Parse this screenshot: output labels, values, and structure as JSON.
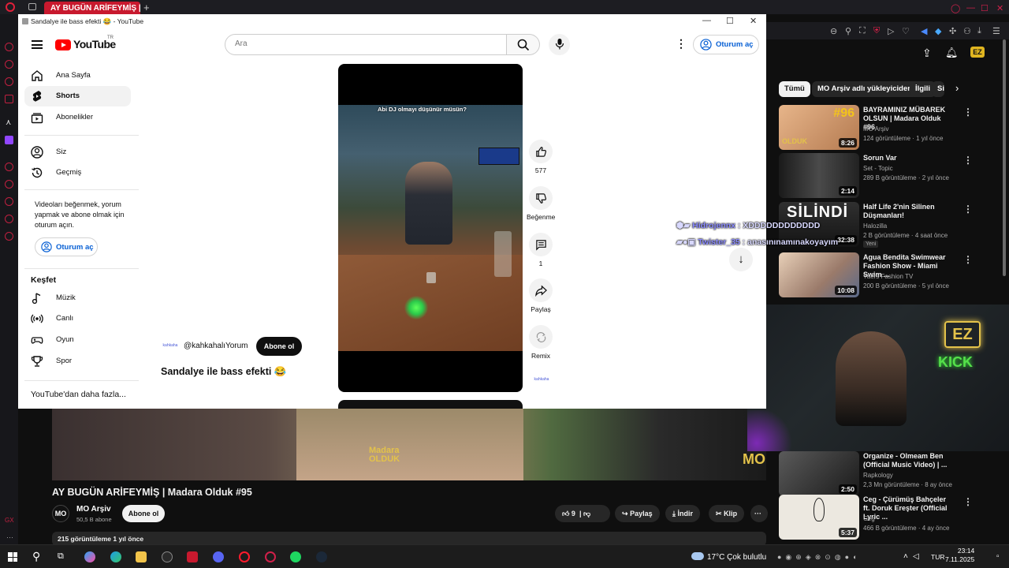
{
  "browser": {
    "tab_title": "AY BUGÜN ARİFEYMİŞ | M",
    "new_tab": "+"
  },
  "pip": {
    "window_title": "Sandalye ile bass efekti 😂 - YouTube",
    "header": {
      "logo_text": "YouTube",
      "logo_region": "TR",
      "search_placeholder": "Ara",
      "sign_in": "Oturum aç"
    },
    "nav": {
      "items": [
        {
          "label": "Ana Sayfa",
          "icon": "home-icon"
        },
        {
          "label": "Shorts",
          "icon": "shorts-icon",
          "active": true
        },
        {
          "label": "Abonelikler",
          "icon": "subscriptions-icon"
        }
      ],
      "you_items": [
        {
          "label": "Siz",
          "icon": "user-icon"
        },
        {
          "label": "Geçmiş",
          "icon": "history-icon"
        }
      ],
      "signin_prompt": "Videoları beğenmek, yorum yapmak ve abone olmak için oturum açın.",
      "signin_button": "Oturum aç",
      "explore_title": "Keşfet",
      "explore_items": [
        {
          "label": "Müzik",
          "icon": "music-icon"
        },
        {
          "label": "Canlı",
          "icon": "live-icon"
        },
        {
          "label": "Oyun",
          "icon": "gaming-icon"
        },
        {
          "label": "Spor",
          "icon": "trophy-icon"
        }
      ],
      "more": "YouTube'dan daha fazla..."
    },
    "short": {
      "caption": "Abi DJ olmayı düşünür müsün?",
      "uploader": "@kahkahalıYorum",
      "subscribe": "Abone ol",
      "title": "Sandalye ile bass efekti 😂",
      "actions": {
        "like_count": "577",
        "dislike_label": "Beğenme",
        "comment_count": "1",
        "share_label": "Paylaş",
        "remix_label": "Remix"
      }
    }
  },
  "chat": {
    "line1_user": "Hidrojennx",
    "line1_text": "XDDDDDDDDDDDD",
    "line2_user": "Twister_35",
    "line2_text": "anasınınamınakoyayım"
  },
  "overlay": {
    "brand": "EZ",
    "brand2": "KICK"
  },
  "background": {
    "chips": [
      "Tümü",
      "MO Arşiv adlı yükleyiciden",
      "İlgili",
      "Si"
    ],
    "recommendations": [
      {
        "title": "BAYRAMINIZ MÜBAREK OLSUN | Madara Olduk #96",
        "channel": "MO Arşiv",
        "meta": "124 görüntüleme · 1 yıl önce",
        "duration": "8:26",
        "thumb_text": "#96",
        "color": "#c78a5a"
      },
      {
        "title": "Sorun Var",
        "channel": "Set - Topic",
        "meta": "289 B görüntüleme · 2 yıl önce",
        "duration": "2:14",
        "thumb_text": "",
        "color": "#3a3a3a"
      },
      {
        "title": "Half Life 2'nin Silinen Düşmanları!",
        "channel": "Halozilla",
        "meta": "2 B görüntüleme · 4 saat önce",
        "duration": "32:38",
        "thumb_text": "SİLİNDİ",
        "color": "#2a2a2a",
        "badge": "Yeni"
      },
      {
        "title": "Agua Bendita Swimwear Fashion Show - Miami Swim ...",
        "channel": "Yaers Fashion TV",
        "meta": "200 B görüntüleme · 5 yıl önce",
        "duration": "10:08",
        "thumb_text": "",
        "color": "#c8a488"
      }
    ],
    "lower_recommendations": [
      {
        "title": "Organize - Olmeam Ben (Official Music Video) | ...",
        "channel": "Rapkology",
        "meta": "2,3 Mn görüntüleme · 8 ay önce",
        "duration": "2:50",
        "color": "#4a4a4a"
      },
      {
        "title": "Ceg - Çürümüş Bahçeler ft. Doruk Ereşter (Official Lyric ...",
        "channel": "Ceg",
        "meta": "466 B görüntüleme · 4 ay önce",
        "duration": "5:37",
        "color": "#ece8e0"
      }
    ],
    "player_watermark": "MO",
    "video_title": "AY BUGÜN ARİFEYMİŞ | Madara Olduk #95",
    "channel_name": "MO Arşiv",
    "channel_avatar": "MO",
    "channel_subs": "50,5 B abone",
    "subscribe": "Abone ol",
    "likes": "9",
    "share": "Paylaş",
    "download": "İndir",
    "clip": "Klip",
    "desc_stats": "215 görüntüleme  1 yıl önce"
  },
  "taskbar": {
    "weather": "17°C  Çok bulutlu",
    "lang": "TUR",
    "time": "23:14",
    "date": "7.11.2025"
  }
}
